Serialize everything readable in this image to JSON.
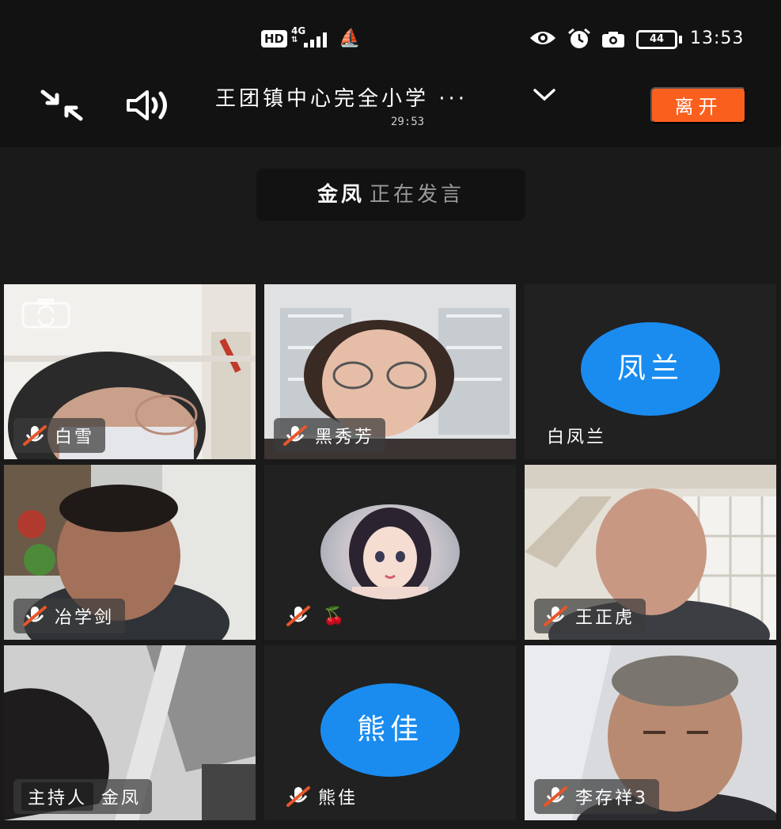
{
  "status_bar": {
    "hd_badge": "HD",
    "network": "4G",
    "time": "13:53",
    "battery": "44"
  },
  "header": {
    "meeting_title": "王团镇中心完全小学 ···",
    "duration": "29:53",
    "leave_label": "离开"
  },
  "speaking_banner": {
    "speaker": "金凤",
    "action": "正在发言"
  },
  "participants": [
    {
      "name": "白雪",
      "mic_muted": true,
      "video": true
    },
    {
      "name": "黑秀芳",
      "mic_muted": true,
      "video": true
    },
    {
      "name": "白凤兰",
      "avatar_text": "凤兰",
      "mic_muted": false,
      "video": false
    },
    {
      "name": "冶学剑",
      "mic_muted": true,
      "video": true
    },
    {
      "name": "🍒",
      "mic_muted": true,
      "video": false,
      "avatar": "cartoon-girl"
    },
    {
      "name": "王正虎",
      "mic_muted": true,
      "video": true
    },
    {
      "name": "金凤",
      "host_badge": "主持人",
      "mic_muted": false,
      "video": true,
      "active_speaker": true
    },
    {
      "name": "熊佳",
      "avatar_text": "熊佳",
      "mic_muted": true,
      "video": false
    },
    {
      "name": "李存祥3",
      "mic_muted": true,
      "video": true
    }
  ],
  "colors": {
    "background": "#121212",
    "tile_background": "#212121",
    "leave_button": "#fa5f1e",
    "avatar_blue": "#1a8cf0",
    "active_border": "#2fbf50",
    "mute_slash": "#e8562a"
  }
}
